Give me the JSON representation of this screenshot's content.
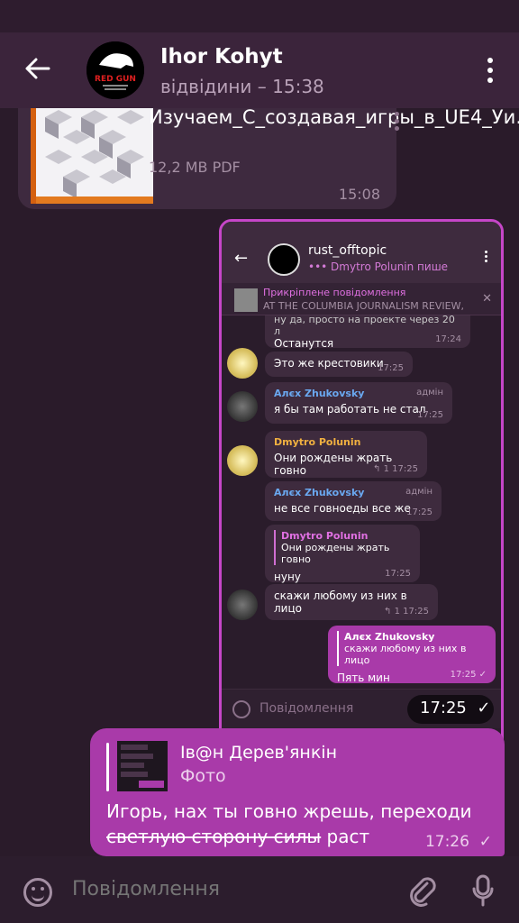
{
  "header": {
    "title": "Ihor Kohyt",
    "subtitle": "відвідини – 15:38",
    "avatar_text": "RED GUN"
  },
  "file_message": {
    "name": "Изучаем_C_создавая_игры_в_UE4_Уи…",
    "size": "12,2 MB PDF",
    "time": "15:08"
  },
  "screenshot": {
    "chat_title": "rust_offtopic",
    "typing": "••• Dmytro Polunin пише",
    "pinned_label": "Прикріплене повідомлення",
    "pinned_text": "AT THE COLUMBIA JOURNALISM REVIEW,",
    "messages": [
      {
        "name": "",
        "text": "ну да, просто на проекте через 20 л",
        "time": ""
      },
      {
        "name": "",
        "text": "Останутся",
        "time": "17:24"
      },
      {
        "name": "",
        "text": "Это же крестовики",
        "time": "17:25"
      },
      {
        "name": "Алєх Zhukovsky",
        "admin": "адмін",
        "text": "я бы там работать не стал",
        "time": "17:25"
      },
      {
        "name": "Dmytro Polunin",
        "text": "Они рождены жрать говно",
        "time": "17:25",
        "replies": "1"
      },
      {
        "name": "Алєх Zhukovsky",
        "admin": "адмін",
        "text": "не все говноеды все же",
        "time": "17:25"
      },
      {
        "quote_name": "Dmytro Polunin",
        "quote_text": "Они рождены жрать говно",
        "text": "нуну",
        "time": "17:25"
      },
      {
        "name": "",
        "text": "скажи любому из них в лицо",
        "time": "17:25",
        "replies": "1"
      },
      {
        "quote_name": "Алєх Zhukovsky",
        "quote_text": "скажи любому из них в лицо",
        "text": "Пять мин",
        "time": "17:25"
      }
    ],
    "input_placeholder": "Повідомлення",
    "overlay_time": "17:25"
  },
  "reply_message": {
    "reply_to": "Ів@н Дерев'янкін",
    "reply_type": "Фото",
    "text_part1": "Игорь, нах ты говно жрешь, переходи",
    "text_strike": "светлую сторону силы",
    "text_part2": " раст",
    "time": "17:26"
  },
  "composer": {
    "placeholder": "Повідомлення"
  },
  "colors": {
    "accent": "#a93aa9",
    "header_bg": "#3b243b",
    "bg": "#2a1b2a"
  }
}
